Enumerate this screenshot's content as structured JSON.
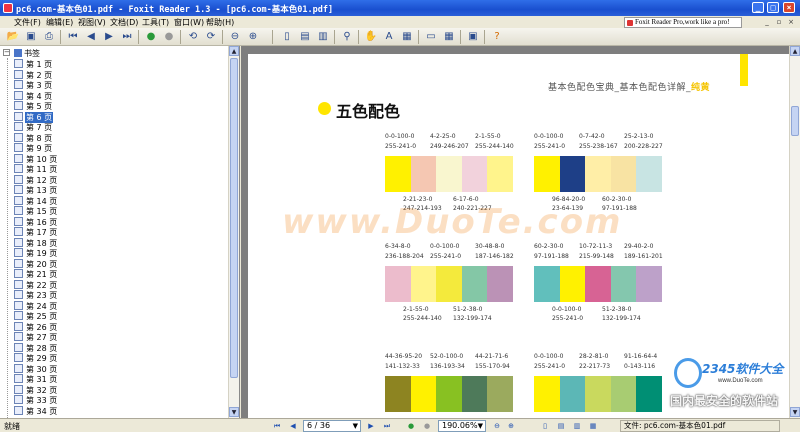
{
  "window": {
    "title": "pc6.com-基本色01.pdf - Foxit Reader 1.3 - [pc6.com-基本色01.pdf]"
  },
  "menu": {
    "items": [
      "文件(F)",
      "编辑(E)",
      "视图(V)",
      "文档(D)",
      "工具(T)",
      "窗口(W)",
      "帮助(H)"
    ],
    "promo": "Foxit Reader Pro,work like a pro!"
  },
  "toolbar": {
    "icons": [
      "open-icon",
      "save-icon",
      "print-icon",
      "first-page-icon",
      "prev-page-icon",
      "next-page-icon",
      "last-page-icon",
      "go-back-icon",
      "go-forward-icon",
      "rotate-left-icon",
      "rotate-right-icon",
      "zoom-out-icon",
      "zoom-in-icon",
      "single-page-icon",
      "continuous-icon",
      "facing-icon",
      "find-icon",
      "hand-tool-icon",
      "text-select-icon",
      "snapshot-icon",
      "view-icon",
      "thumb-icon",
      "fullscreen-icon",
      "help-icon"
    ]
  },
  "bookmarks": {
    "root": "书签",
    "items": [
      "第 1 页",
      "第 2 页",
      "第 3 页",
      "第 4 页",
      "第 5 页",
      "第 6 页",
      "第 7 页",
      "第 8 页",
      "第 9 页",
      "第 10 页",
      "第 11 页",
      "第 12 页",
      "第 13 页",
      "第 14 页",
      "第 15 页",
      "第 16 页",
      "第 17 页",
      "第 18 页",
      "第 19 页",
      "第 20 页",
      "第 21 页",
      "第 22 页",
      "第 23 页",
      "第 24 页",
      "第 25 页",
      "第 26 页",
      "第 27 页",
      "第 28 页",
      "第 29 页",
      "第 30 页",
      "第 31 页",
      "第 32 页",
      "第 33 页",
      "第 34 页"
    ],
    "selected_index": 5
  },
  "page": {
    "header_prefix": "基本色配色宝典_基本色配色详解_",
    "header_highlight": "纯黄",
    "title": "五色配色",
    "watermark": "www.DuoTe.com",
    "groups": [
      {
        "top_codes": [
          [
            "0-0-100-0",
            "255-241-0"
          ],
          [
            "4-2-25-0",
            "249-246-207"
          ],
          [
            "2-1-55-0",
            "255-244-140"
          ]
        ],
        "colors": [
          "#fff100",
          "#f5c7b2",
          "#f9f6cf",
          "#f2d2dc",
          "#fff48c"
        ],
        "bottom_codes": [
          [
            "2-21-23-0",
            "247-214-193"
          ],
          [
            "6-17-6-0",
            "240-221-227"
          ]
        ]
      },
      {
        "top_codes": [
          [
            "0-0-100-0",
            "255-241-0"
          ],
          [
            "0-7-42-0",
            "255-238-167"
          ],
          [
            "25-2-13-0",
            "200-228-227"
          ]
        ],
        "colors": [
          "#fff100",
          "#1e3f87",
          "#ffeea7",
          "#f8e3a3",
          "#c8e4e3"
        ],
        "bottom_codes": [
          [
            "96-84-20-0",
            "23-64-139"
          ],
          [
            "60-2-30-0",
            "97-191-188"
          ]
        ]
      },
      {
        "top_codes": [
          [
            "6-34-8-0",
            "236-188-204"
          ],
          [
            "0-0-100-0",
            "255-241-0"
          ],
          [
            "30-48-8-0",
            "187-146-182"
          ]
        ],
        "colors": [
          "#ecbccc",
          "#fff48c",
          "#f4ea3c",
          "#84c7a6",
          "#bb92b6"
        ],
        "bottom_codes": [
          [
            "2-1-55-0",
            "255-244-140"
          ],
          [
            "51-2-38-0",
            "132-199-174"
          ]
        ]
      },
      {
        "top_codes": [
          [
            "60-2-30-0",
            "97-191-188"
          ],
          [
            "10-72-11-3",
            "215-99-148"
          ],
          [
            "29-40-2-0",
            "189-161-201"
          ]
        ],
        "colors": [
          "#61bfbc",
          "#fff100",
          "#d76394",
          "#84c7ae",
          "#bda1c9"
        ],
        "bottom_codes": [
          [
            "0-0-100-0",
            "255-241-0"
          ],
          [
            "51-2-38-0",
            "132-199-174"
          ]
        ]
      },
      {
        "top_codes": [
          [
            "44-36-95-20",
            "141-132-33"
          ],
          [
            "52-0-100-0",
            "136-193-34"
          ],
          [
            "44-21-71-6",
            "155-170-94"
          ]
        ],
        "colors": [
          "#8d8421",
          "#fff100",
          "#88c122",
          "#4e7a5a",
          "#9baa5e"
        ],
        "bottom_codes": []
      },
      {
        "top_codes": [
          [
            "0-0-100-0",
            "255-241-0"
          ],
          [
            "28-2-81-0",
            "22-217-73"
          ],
          [
            "91-16-64-4",
            "0-143-116"
          ]
        ],
        "colors": [
          "#fff100",
          "#5cb7b6",
          "#c9d95e",
          "#a8cc72",
          "#008f74"
        ],
        "bottom_codes": []
      }
    ]
  },
  "status": {
    "left": "就绪",
    "page_indicator": "6 / 36",
    "zoom": "190.06%",
    "file": "文件: pc6.com-基本色01.pdf"
  },
  "overlay": {
    "logo_brand": "2345软件大全",
    "logo_url": "www.DuoTe.com",
    "logo_slogan": "国内最安全的软件站"
  }
}
